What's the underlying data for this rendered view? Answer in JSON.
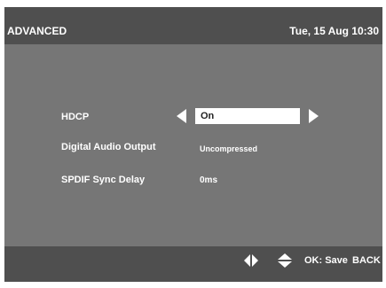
{
  "header": {
    "title": "ADVANCED",
    "datetime": "Tue, 15 Aug 10:30"
  },
  "settings": [
    {
      "label": "HDCP",
      "value": "On",
      "selected": true
    },
    {
      "label": "Digital Audio Output",
      "value": "Uncompressed",
      "selected": false
    },
    {
      "label": "SPDIF Sync Delay",
      "value": "0ms",
      "selected": false
    }
  ],
  "footer": {
    "lr_icon": "left-right-arrows-icon",
    "ud_icon": "up-down-arrows-icon",
    "ok_label": "OK: Save",
    "back_label": "BACK"
  },
  "colors": {
    "panel": "#767676",
    "bar": "#4f4f4f",
    "text": "#ffffff",
    "selected_box": "#ffffff",
    "selected_text": "#222222"
  }
}
